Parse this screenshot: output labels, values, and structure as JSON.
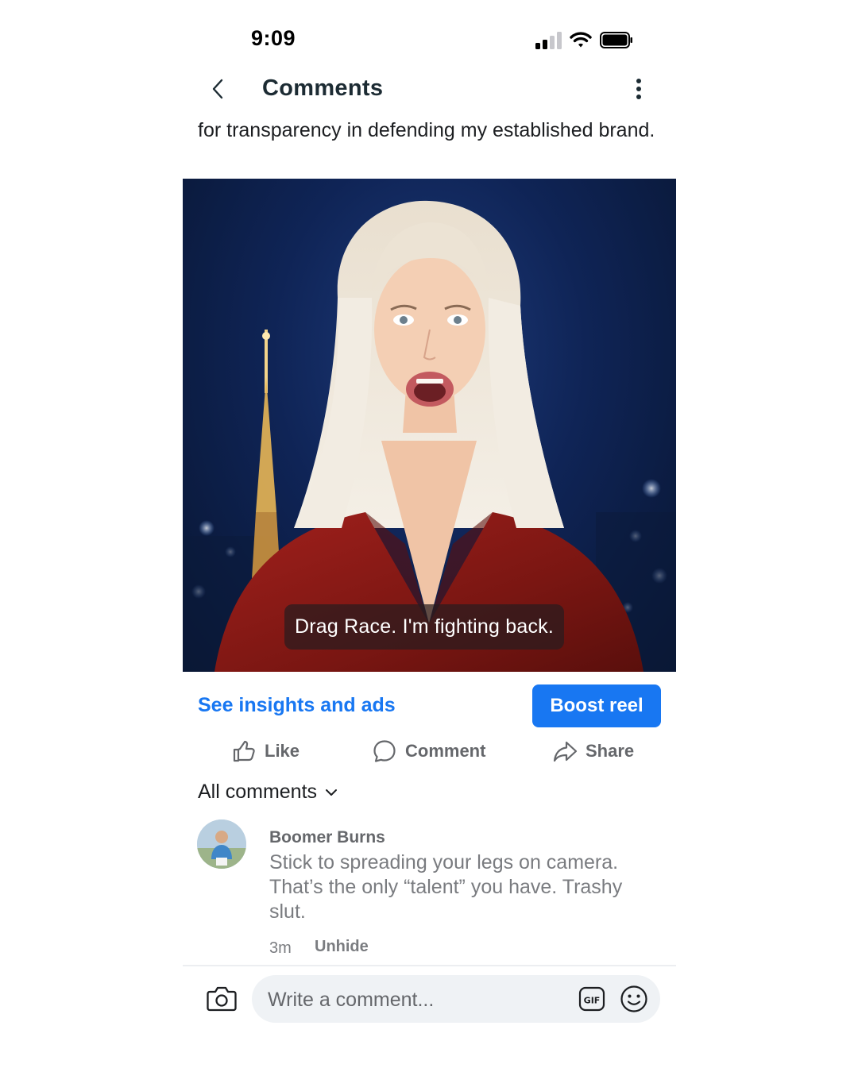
{
  "status_bar": {
    "time": "9:09"
  },
  "header": {
    "title": "Comments"
  },
  "post": {
    "caption": "for transparency in defending my established brand.",
    "video_subtitle": "Drag Race. I'm fighting back."
  },
  "actions": {
    "insights_label": "See insights and ads",
    "boost_label": "Boost reel",
    "like_label": "Like",
    "comment_label": "Comment",
    "share_label": "Share"
  },
  "comments_section": {
    "filter_label": "All comments",
    "items": [
      {
        "author": "Boomer Burns",
        "text": "Stick to spreading your legs on camera. That’s the only “talent” you have. Trashy slut.",
        "time": "3m",
        "action_label": "Unhide"
      }
    ]
  },
  "composer": {
    "placeholder": "Write a comment..."
  },
  "colors": {
    "accent": "#1877f2",
    "muted": "#65676b"
  },
  "icons": [
    "back-chevron-icon",
    "more-vertical-icon",
    "like-icon",
    "comment-icon",
    "share-icon",
    "chevron-down-icon",
    "camera-icon",
    "gif-icon",
    "emoji-icon"
  ]
}
